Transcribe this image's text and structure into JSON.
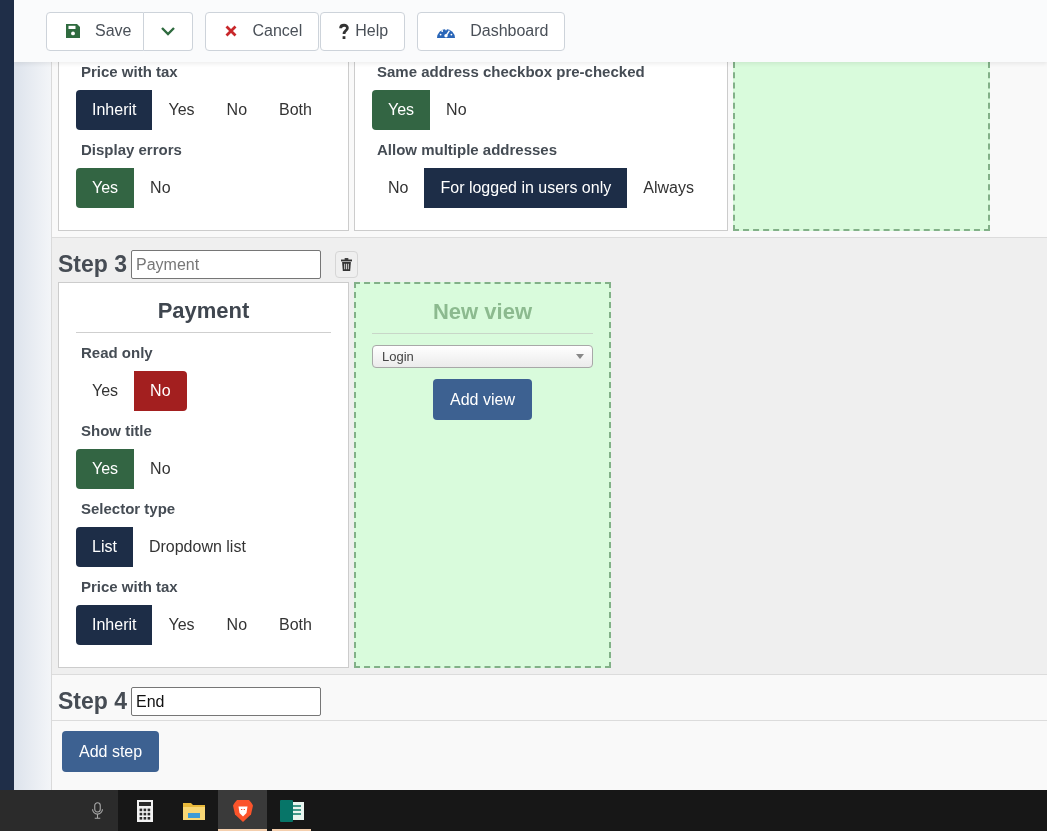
{
  "toolbar": [
    {
      "kind": "save",
      "label": "Save",
      "split": true
    },
    {
      "kind": "cancel",
      "label": "Cancel"
    },
    {
      "kind": "help",
      "label": "Help"
    },
    {
      "kind": "dashboard",
      "label": "Dashboard"
    }
  ],
  "steps": [
    {
      "columns": [
        {
          "kind": "view",
          "fields": [
            {
              "label": "Price with tax",
              "options": [
                {
                  "label": "Inherit",
                  "selected": true,
                  "color": "#1d2d47"
                },
                {
                  "label": "Yes",
                  "selected": false
                },
                {
                  "label": "No",
                  "selected": false
                },
                {
                  "label": "Both",
                  "selected": false
                }
              ]
            },
            {
              "label": "Display errors",
              "options": [
                {
                  "label": "Yes",
                  "selected": true,
                  "color": "#336543"
                },
                {
                  "label": "No",
                  "selected": false
                }
              ]
            }
          ]
        },
        {
          "kind": "view",
          "fields": [
            {
              "label": "Same address checkbox pre-checked",
              "options": [
                {
                  "label": "Yes",
                  "selected": true,
                  "color": "#336543"
                },
                {
                  "label": "No",
                  "selected": false
                }
              ]
            },
            {
              "label": "Allow multiple addresses",
              "options": [
                {
                  "label": "No",
                  "selected": false
                },
                {
                  "label": "For logged in users only",
                  "selected": true,
                  "color": "#1d2d47"
                },
                {
                  "label": "Always",
                  "selected": false
                }
              ]
            }
          ]
        },
        {
          "kind": "new_view"
        }
      ]
    },
    {
      "label": "Step 3",
      "name_field": {
        "placeholder": "Payment"
      },
      "delete_button": true,
      "columns": [
        {
          "kind": "view",
          "title": "Payment",
          "fields": [
            {
              "label": "Read only",
              "options": [
                {
                  "label": "Yes",
                  "selected": false
                },
                {
                  "label": "No",
                  "selected": true,
                  "color": "#a31f1f"
                }
              ]
            },
            {
              "label": "Show title",
              "options": [
                {
                  "label": "Yes",
                  "selected": true,
                  "color": "#336543"
                },
                {
                  "label": "No",
                  "selected": false
                }
              ]
            },
            {
              "label": "Selector type",
              "options": [
                {
                  "label": "List",
                  "selected": true,
                  "color": "#1d2d47"
                },
                {
                  "label": "Dropdown list",
                  "selected": false
                }
              ]
            },
            {
              "label": "Price with tax",
              "options": [
                {
                  "label": "Inherit",
                  "selected": true,
                  "color": "#1d2d47"
                },
                {
                  "label": "Yes",
                  "selected": false
                },
                {
                  "label": "No",
                  "selected": false
                },
                {
                  "label": "Both",
                  "selected": false
                }
              ]
            }
          ]
        },
        {
          "kind": "new_view",
          "title": "New view",
          "select": "Login",
          "button": "Add view"
        }
      ]
    },
    {
      "label": "Step 4",
      "name_field": {
        "value": "End"
      }
    }
  ],
  "add_step_button": "Add step",
  "taskbar": {
    "search_box": {
      "voice_input": true
    },
    "apps": [
      {
        "kind": "calculator",
        "running": false,
        "active": false
      },
      {
        "kind": "folder",
        "running": false,
        "active": false
      },
      {
        "kind": "browser",
        "running": true,
        "active": true
      },
      {
        "kind": "publisher",
        "running": true,
        "active": false
      }
    ]
  }
}
